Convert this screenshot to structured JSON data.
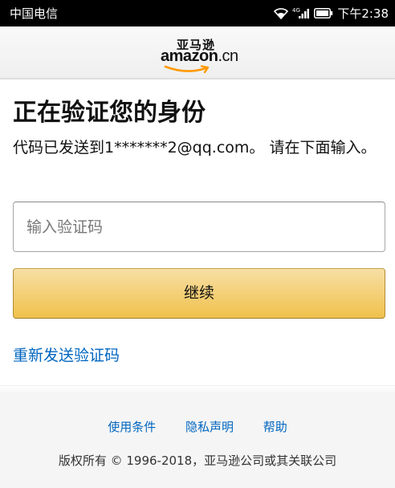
{
  "status_bar": {
    "carrier": "中国电信",
    "network_type": "4G",
    "time": "下午2:38"
  },
  "header": {
    "logo_cn": "亚马逊",
    "logo_word": "amazon",
    "logo_suffix": ".cn"
  },
  "main": {
    "title": "正在验证您的身份",
    "description": "代码已发送到1*******2@qq.com。 请在下面输入。",
    "code_placeholder": "输入验证码",
    "code_value": "",
    "continue_label": "继续",
    "resend_label": "重新发送验证码"
  },
  "footer": {
    "links": [
      "使用条件",
      "隐私声明",
      "帮助"
    ],
    "copyright": "版权所有 © 1996-2018，亚马逊公司或其关联公司"
  },
  "colors": {
    "link": "#0066c0",
    "button_top": "#f7dfa5",
    "button_bottom": "#f0c14b",
    "smile": "#f90"
  }
}
